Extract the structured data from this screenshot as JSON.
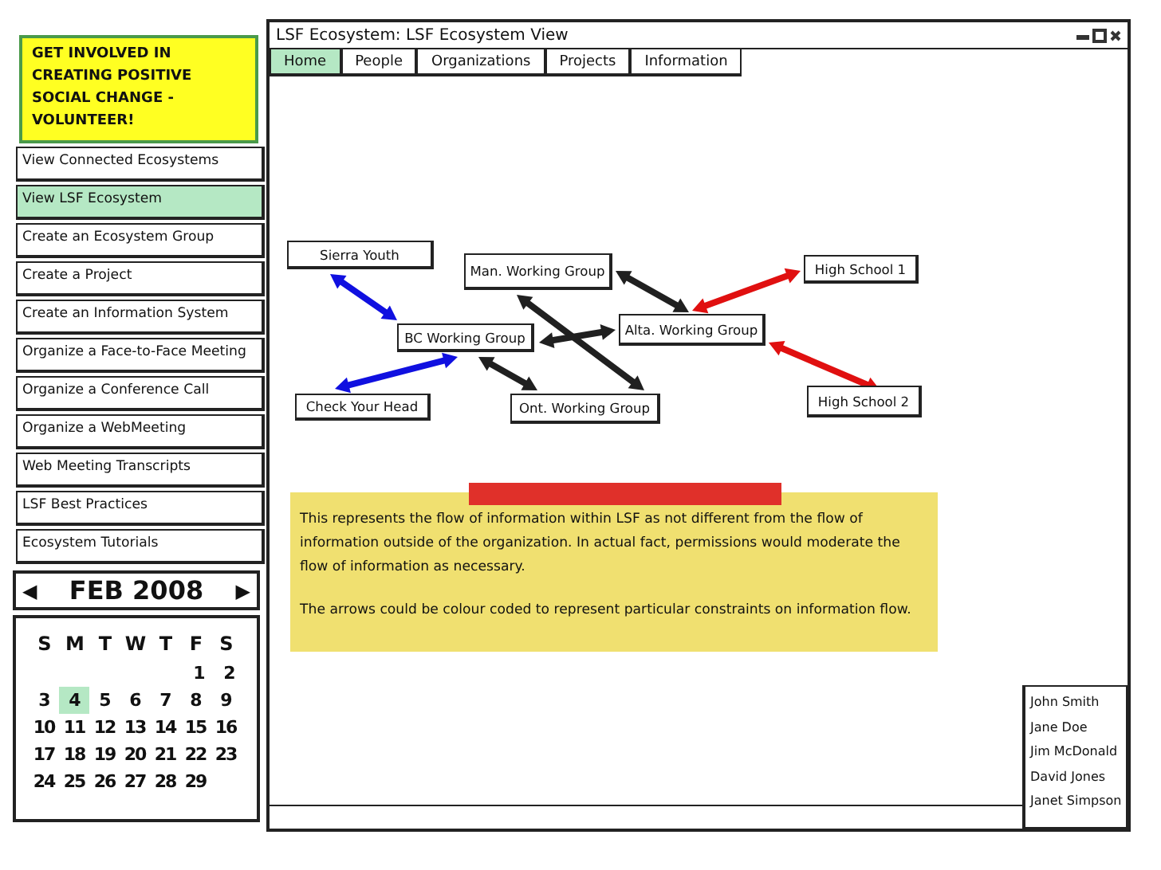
{
  "promo": {
    "text": "GET INVOLVED IN CREATING POSITIVE SOCIAL CHANGE - VOLUNTEER!"
  },
  "nav": [
    {
      "label": "View Connected Ecosystems",
      "selected": false
    },
    {
      "label": "View LSF Ecosystem",
      "selected": true
    },
    {
      "label": "Create an Ecosystem Group",
      "selected": false
    },
    {
      "label": "Create a Project",
      "selected": false
    },
    {
      "label": "Create an Information System",
      "selected": false
    },
    {
      "label": "Organize a Face-to-Face Meeting",
      "selected": false
    },
    {
      "label": "Organize a Conference Call",
      "selected": false
    },
    {
      "label": "Organize a WebMeeting",
      "selected": false
    },
    {
      "label": "Web Meeting Transcripts",
      "selected": false
    },
    {
      "label": "LSF Best Practices",
      "selected": false
    },
    {
      "label": "Ecosystem Tutorials",
      "selected": false
    }
  ],
  "calendar": {
    "prev": "◀",
    "month": "FEB 2008",
    "next": "▶",
    "weekdays": [
      "S",
      "M",
      "T",
      "W",
      "T",
      "F",
      "S"
    ],
    "weeks": [
      [
        {
          "day": "1",
          "selected": false
        },
        {
          "day": "2",
          "selected": false
        }
      ],
      [
        {
          "day": "3",
          "selected": false
        },
        {
          "day": "4",
          "selected": true
        },
        {
          "day": "5",
          "selected": false
        },
        {
          "day": "6",
          "selected": false
        },
        {
          "day": "7",
          "selected": false
        },
        {
          "day": "8",
          "selected": false
        },
        {
          "day": "9",
          "selected": false
        }
      ],
      [
        {
          "day": "10",
          "selected": false
        },
        {
          "day": "11",
          "selected": false
        },
        {
          "day": "12",
          "selected": false
        },
        {
          "day": "13",
          "selected": false
        },
        {
          "day": "14",
          "selected": false
        },
        {
          "day": "15",
          "selected": false
        },
        {
          "day": "16",
          "selected": false
        }
      ],
      [
        {
          "day": "17",
          "selected": false
        },
        {
          "day": "18",
          "selected": false
        },
        {
          "day": "19",
          "selected": false
        },
        {
          "day": "20",
          "selected": false
        },
        {
          "day": "21",
          "selected": false
        },
        {
          "day": "22",
          "selected": false
        },
        {
          "day": "23",
          "selected": false
        }
      ],
      [
        {
          "day": "24",
          "selected": false
        },
        {
          "day": "25",
          "selected": false
        },
        {
          "day": "26",
          "selected": false
        },
        {
          "day": "27",
          "selected": false
        },
        {
          "day": "28",
          "selected": false
        },
        {
          "day": "29",
          "selected": false
        }
      ]
    ]
  },
  "window": {
    "title": "LSF Ecosystem: LSF Ecosystem View"
  },
  "tabs": [
    {
      "label": "Home",
      "selected": true
    },
    {
      "label": "People",
      "selected": false
    },
    {
      "label": "Organizations",
      "selected": false
    },
    {
      "label": "Projects",
      "selected": false
    },
    {
      "label": "Information",
      "selected": false
    }
  ],
  "diagram": {
    "nodes": [
      {
        "label": "Sierra Youth"
      },
      {
        "label": "Man. Working Group"
      },
      {
        "label": "High School 1"
      },
      {
        "label": "BC Working Group"
      },
      {
        "label": "Alta. Working Group"
      },
      {
        "label": "Check Your Head"
      },
      {
        "label": "Ont. Working Group"
      },
      {
        "label": "High School 2"
      }
    ],
    "edges": [
      {
        "color": "#1010e0"
      },
      {
        "color": "#1010e0"
      },
      {
        "color": "#202020"
      },
      {
        "color": "#202020"
      },
      {
        "color": "#202020"
      },
      {
        "color": "#202020"
      },
      {
        "color": "#e01010"
      },
      {
        "color": "#e01010"
      }
    ]
  },
  "note": {
    "paragraphs": [
      "This represents the flow of information within LSF as not different from the flow of information outside of the organization. In actual fact, permissions would moderate the flow of information as necessary.",
      "The arrows could be colour coded to represent particular constraints on information flow."
    ]
  },
  "people": [
    "John Smith",
    "Jane Doe",
    "Jim McDonald",
    "David Jones",
    "Janet Simpson"
  ]
}
